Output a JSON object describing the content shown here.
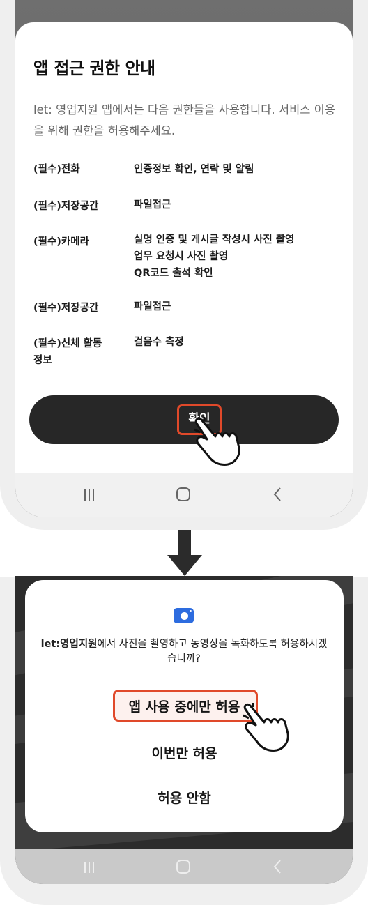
{
  "sheet": {
    "title": "앱 접근 권한 안내",
    "description": "let: 영업지원 앱에서는 다음 권한들을 사용합니다. 서비스 이용을 위해 권한을 허용해주세요.",
    "permissions": [
      {
        "label": "(필수)전화",
        "value": "인증정보 확인, 연락 및 알림"
      },
      {
        "label": "(필수)저장공간",
        "value": "파일접근"
      },
      {
        "label": "(필수)카메라",
        "value": "실명 인증 및 게시글 작성시 사진 촬영\n업무 요청시 사진 촬영\nQR코드 출석 확인"
      },
      {
        "label": "(필수)저장공간",
        "value": "파일접근"
      },
      {
        "label": "(필수)신체 활동\n정보",
        "value": "걸음수 측정"
      }
    ],
    "confirm_label": "확인"
  },
  "dialog": {
    "app_name": "let:영업지원",
    "message_rest": "에서 사진을 촬영하고 동영상을 녹화하도록 허용하시겠습니까?",
    "option_while_using": "앱 사용 중에만 허용",
    "option_once": "이번만 허용",
    "option_deny": "허용 안함"
  },
  "colors": {
    "highlight": "#e0492a",
    "confirm_button": "#272727",
    "camera_icon": "#2d6cdf"
  },
  "icons": [
    "recent-apps-icon",
    "home-icon",
    "back-icon",
    "hand-pointer-icon",
    "down-arrow-icon",
    "camera-icon"
  ]
}
